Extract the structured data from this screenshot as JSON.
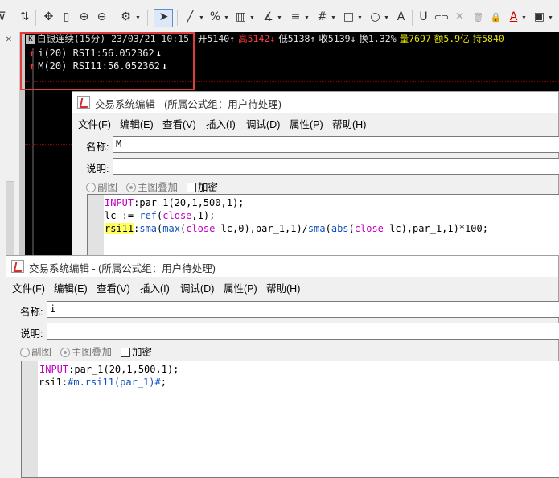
{
  "toolbar": {
    "icons": [
      {
        "name": "filter-icon",
        "glyph": "⊽"
      },
      {
        "name": "sort-icon",
        "glyph": "⇅"
      },
      {
        "name": "move-icon",
        "glyph": "✥"
      },
      {
        "name": "bar-icon",
        "glyph": "▯"
      },
      {
        "name": "zoom-in-icon",
        "glyph": "⊕"
      },
      {
        "name": "zoom-out-icon",
        "glyph": "⊖"
      },
      {
        "name": "settings-icon",
        "glyph": "⚙"
      },
      {
        "name": "cursor-icon",
        "glyph": "➤"
      },
      {
        "name": "line-tool-icon",
        "glyph": "╱"
      },
      {
        "name": "percent-tool-icon",
        "glyph": "%"
      },
      {
        "name": "ruler-tool-icon",
        "glyph": "▥"
      },
      {
        "name": "angle-tool-icon",
        "glyph": "∡"
      },
      {
        "name": "level-tool-icon",
        "glyph": "≡"
      },
      {
        "name": "grid-tool-icon",
        "glyph": "#"
      },
      {
        "name": "rect-tool-icon",
        "glyph": "□"
      },
      {
        "name": "circle-tool-icon",
        "glyph": "○"
      },
      {
        "name": "text-tool-icon",
        "glyph": "A"
      },
      {
        "name": "magnet-icon",
        "glyph": "U"
      },
      {
        "name": "link-icon",
        "glyph": "⊂⊃"
      },
      {
        "name": "delete-icon",
        "glyph": "✕"
      },
      {
        "name": "trash-icon",
        "glyph": "🗑"
      },
      {
        "name": "lock-icon",
        "glyph": "🔒"
      },
      {
        "name": "color-icon",
        "glyph": "A"
      },
      {
        "name": "save-icon",
        "glyph": "▣"
      }
    ]
  },
  "chart": {
    "header": {
      "k_label": "K",
      "title": "白银连续(15分) 23/03/21 10:15",
      "open": "开5140↑",
      "high": "高5142↓",
      "low": "低5138↑",
      "close": "收5139↓",
      "turnover": "换1.32%",
      "volume": "量7697",
      "amount": "额5.9亿",
      "hold": "持5840"
    },
    "indicators": [
      {
        "name": "i(20)",
        "value": "RSI1:56.052362",
        "arrow_up": "↑",
        "arrow_down": "↓"
      },
      {
        "name": "M(20)",
        "value": "RSI11:56.052362",
        "arrow_up": "↑",
        "arrow_down": "↓"
      }
    ],
    "colors": {
      "background": "#000000",
      "up": "#ff3030",
      "highlight_box": "#e23b3b"
    }
  },
  "editor_back": {
    "title": "交易系统编辑 - (所属公式组：用户待处理)",
    "menu": [
      "文件(F)",
      "编辑(E)",
      "查看(V)",
      "插入(I)",
      "调试(D)",
      "属性(P)",
      "帮助(H)"
    ],
    "name_label": "名称:",
    "name_value": "M",
    "desc_label": "说明:",
    "desc_value": "",
    "options": {
      "sub": "副图",
      "main": "主图叠加",
      "encrypt": "加密"
    },
    "code": {
      "line1_kw": "INPUT",
      "line1_rest": ":par_1(20,1,500,1);",
      "line2_a": "lc := ",
      "line2_fn": "ref",
      "line2_b": "(",
      "line2_kw": "close",
      "line2_c": ",1);",
      "line3_hl": "rsi11",
      "line3_rest_a": ":",
      "line3_sma": "sma",
      "line3_b": "(",
      "line3_max": "max",
      "line3_c": "(",
      "line3_close1": "close",
      "line3_d": "-lc,0),par_1,1)/",
      "line3_sma2": "sma",
      "line3_e": "(",
      "line3_abs": "abs",
      "line3_f": "(",
      "line3_close2": "close",
      "line3_g": "-lc),par_1,1)*100;"
    }
  },
  "editor_front": {
    "title": "交易系统编辑 - (所属公式组：用户待处理)",
    "menu": [
      "文件(F)",
      "编辑(E)",
      "查看(V)",
      "插入(I)",
      "调试(D)",
      "属性(P)",
      "帮助(H)"
    ],
    "name_label": "名称:",
    "name_value": "i",
    "desc_label": "说明:",
    "desc_value": "",
    "options": {
      "sub": "副图",
      "main": "主图叠加",
      "encrypt": "加密"
    },
    "code": {
      "line1_kw": "INPUT",
      "line1_rest": ":par_1(20,1,500,1);",
      "line2_a": "rsi1:",
      "line2_ref": "#m.rsi11(par_1)#",
      "line2_b": ";"
    }
  }
}
